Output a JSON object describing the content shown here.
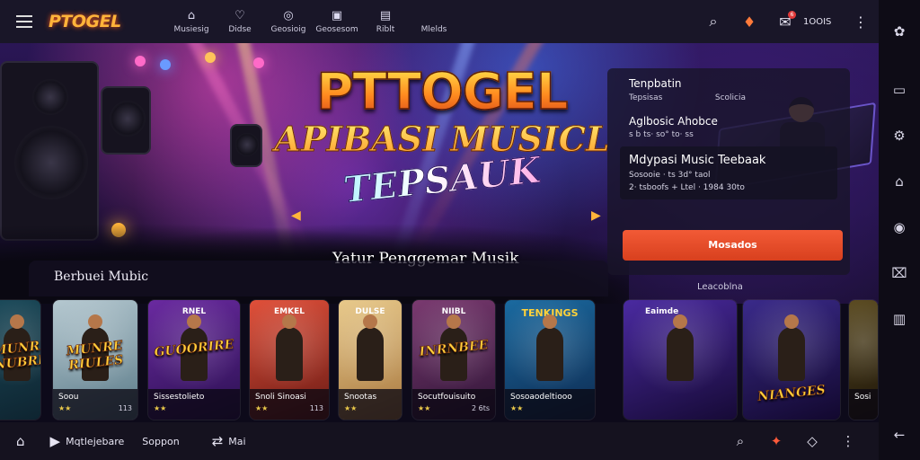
{
  "brand": {
    "logo": "PTOGEL"
  },
  "topnav": [
    {
      "label": "Musiesig",
      "icon": "home-icon",
      "glyph": "⌂"
    },
    {
      "label": "Didse",
      "icon": "heart-icon",
      "glyph": "♡"
    },
    {
      "label": "Geosioig",
      "icon": "disc-icon",
      "glyph": "◎"
    },
    {
      "label": "Geosesom",
      "icon": "library-icon",
      "glyph": "▣"
    },
    {
      "label": "Riblt",
      "icon": "playlist-icon",
      "glyph": "▤"
    },
    {
      "label": "Mlelds",
      "icon": "",
      "glyph": ""
    }
  ],
  "top_actions": {
    "count_label": "1OOIS",
    "notif_count": "6"
  },
  "hero": {
    "title_line1": "PTTOGEL",
    "title_line2": "APIBASI MUSICL",
    "title_line3": "TEPSAUK",
    "caption": "Yatur Penggemar Musik"
  },
  "info_panel": {
    "header_title": "Tenpbatin",
    "header_row": [
      "Tepsisas",
      "Scolicia"
    ],
    "subtitle": "Aglbosic Ahobce",
    "subline": "s b ts· so° to· ss",
    "card_title": "Mdypasi Music Teebaak",
    "card_line1": "Sosooie · ts 3d° taol",
    "card_line2": "2· tsboofs  +  Ltel  ·  1984 30to",
    "cta_label": "Mosados"
  },
  "section": {
    "title": "Berbuei Mubic",
    "side_label": "Leacoblna"
  },
  "cards": [
    {
      "badge": "",
      "title": "MUNRE NUBRE",
      "name": "",
      "stars": "",
      "num": "",
      "colors": [
        "#1b4a5a",
        "#0e2430"
      ]
    },
    {
      "badge": "",
      "title": "MUNRE RIULES",
      "name": "Soou",
      "stars": "★★",
      "num": "113",
      "colors": [
        "#b5c8d0",
        "#5a7a88"
      ]
    },
    {
      "badge": "RNEL",
      "title": "GUOORIRE",
      "name": "Sissestolieto",
      "stars": "★★",
      "num": "",
      "colors": [
        "#6a2aa0",
        "#2a1050"
      ]
    },
    {
      "badge": "EMKEL",
      "title": "",
      "name": "Snoli Sinoasi",
      "stars": "★★",
      "num": "113",
      "colors": [
        "#e0503a",
        "#6a1a14"
      ]
    },
    {
      "badge": "DULSE",
      "title": "",
      "name": "Snootas",
      "stars": "★★",
      "num": "",
      "colors": [
        "#e8c98a",
        "#a87840"
      ]
    },
    {
      "badge": "NIIBL",
      "title": "INRNBEE",
      "name": "Socutfouisuito",
      "stars": "★★",
      "num": "2 6ts",
      "colors": [
        "#7a3a70",
        "#2e1436"
      ]
    },
    {
      "badge": "TENKINGS",
      "title": "",
      "name": "Sosoaodeltiooo",
      "stars": "★★",
      "num": "",
      "colors": [
        "#1a6aa0",
        "#0e2a50"
      ]
    },
    {
      "badge": "Eaimde",
      "title": "",
      "name": "",
      "stars": "",
      "num": "",
      "colors": [
        "#4a2aa0",
        "#160a36"
      ]
    },
    {
      "badge": "",
      "title": "NIANGES",
      "name": "",
      "stars": "",
      "num": "",
      "colors": [
        "#3a2a8a",
        "#12082e"
      ]
    },
    {
      "badge": "",
      "title": "",
      "name": "Sosi",
      "stars": "",
      "num": "",
      "colors": [
        "#5a4a20",
        "#1e160a"
      ]
    }
  ],
  "bottombar": {
    "left": [
      {
        "label": "",
        "icon": "home-icon",
        "glyph": "⌂"
      },
      {
        "label": "Mqtlejebare",
        "icon": "play-icon",
        "glyph": "▶"
      },
      {
        "label": "Soppon",
        "icon": "",
        "glyph": ""
      },
      {
        "label": "Mai",
        "icon": "shuffle-icon",
        "glyph": "⇄"
      }
    ]
  },
  "rail_icons": [
    "settings-icon",
    "chat-icon",
    "gear-icon",
    "home-icon",
    "record-icon",
    "map-icon",
    "book-icon"
  ]
}
